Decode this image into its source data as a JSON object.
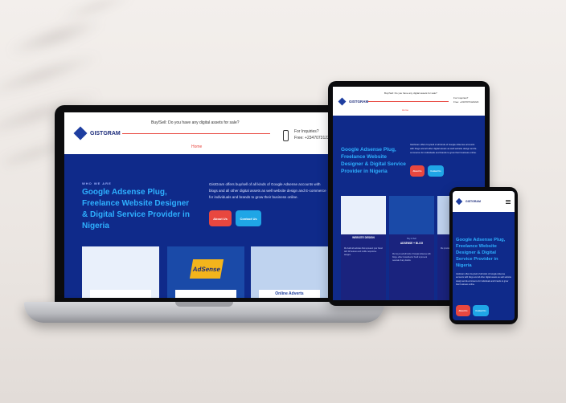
{
  "site": {
    "brand": "GISTGRAM",
    "top_notice": "Buy/Sell: Do you have any digital assets for sale?",
    "nav_home": "Home",
    "inquiries_label": "For Inquiries?",
    "inquiries_phone": "Free: +2347073122222",
    "eyebrow": "WHO WE ARE",
    "headline": "Google Adsense Plug, Freelance Website Designer & Digital Service Provider in Nigeria",
    "description": "GistGram offers buy/sell of all kinds of Google Adsense accounts with blogs and all other digital assets as well website design and E-commerce for individuals and brands to grow their business online.",
    "about_button": "About Us",
    "contact_button": "Contact Us"
  },
  "laptop_cards": [
    {
      "label": ""
    },
    {
      "label": "AdSense"
    },
    {
      "label": "Online Adverts"
    }
  ],
  "tablet_cards": [
    {
      "small": "",
      "title": "WEBSITE DESIGN",
      "body": "We build all websites that represent your brand with full features and mobile responsive designs."
    },
    {
      "small": "Buy & Sell",
      "title": "ADSENSE + BLOG",
      "body": "We buy & sell all kinds of Google Adsense with blogs, either monetized or fresh to prevent reversal of any doubts."
    },
    {
      "small": "",
      "title": "DIGI",
      "body": "We provide top digital marketing services."
    }
  ],
  "colors": {
    "site_bg": "#0f2a8a",
    "headline": "#2eb0ff",
    "button_red": "#e8473f",
    "button_blue": "#1fa6e6"
  }
}
